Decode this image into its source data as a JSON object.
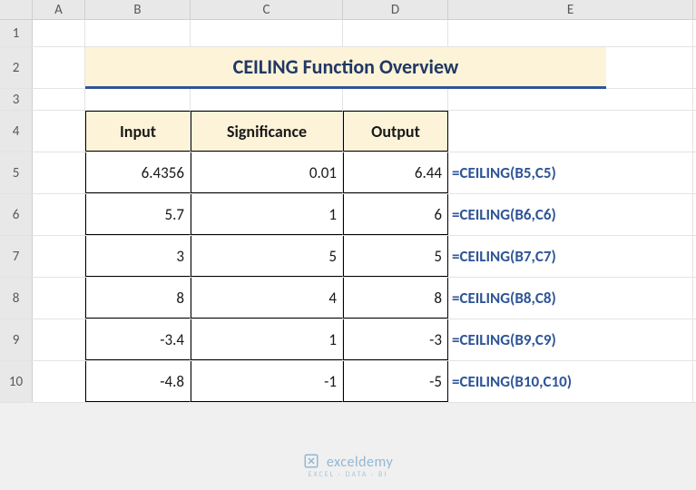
{
  "columns": [
    "A",
    "B",
    "C",
    "D",
    "E"
  ],
  "rows": [
    "1",
    "2",
    "3",
    "4",
    "5",
    "6",
    "7",
    "8",
    "9",
    "10"
  ],
  "title": "CEILING Function Overview",
  "headers": {
    "input": "Input",
    "significance": "Significance",
    "output": "Output"
  },
  "data": [
    {
      "input": "6.4356",
      "sig": "0.01",
      "out": "6.44",
      "formula": "=CEILING(B5,C5)"
    },
    {
      "input": "5.7",
      "sig": "1",
      "out": "6",
      "formula": "=CEILING(B6,C6)"
    },
    {
      "input": "3",
      "sig": "5",
      "out": "5",
      "formula": "=CEILING(B7,C7)"
    },
    {
      "input": "8",
      "sig": "4",
      "out": "8",
      "formula": "=CEILING(B8,C8)"
    },
    {
      "input": "-3.4",
      "sig": "1",
      "out": "-3",
      "formula": "=CEILING(B9,C9)"
    },
    {
      "input": "-4.8",
      "sig": "-1",
      "out": "-5",
      "formula": "=CEILING(B10,C10)"
    }
  ],
  "watermark": {
    "name": "exceldemy",
    "tagline": "EXCEL · DATA · BI"
  },
  "chart_data": {
    "type": "table",
    "title": "CEILING Function Overview",
    "columns": [
      "Input",
      "Significance",
      "Output",
      "Formula"
    ],
    "rows": [
      [
        6.4356,
        0.01,
        6.44,
        "=CEILING(B5,C5)"
      ],
      [
        5.7,
        1,
        6,
        "=CEILING(B6,C6)"
      ],
      [
        3,
        5,
        5,
        "=CEILING(B7,C7)"
      ],
      [
        8,
        4,
        8,
        "=CEILING(B8,C8)"
      ],
      [
        -3.4,
        1,
        -3,
        "=CEILING(B9,C9)"
      ],
      [
        -4.8,
        -1,
        -5,
        "=CEILING(B10,C10)"
      ]
    ]
  }
}
